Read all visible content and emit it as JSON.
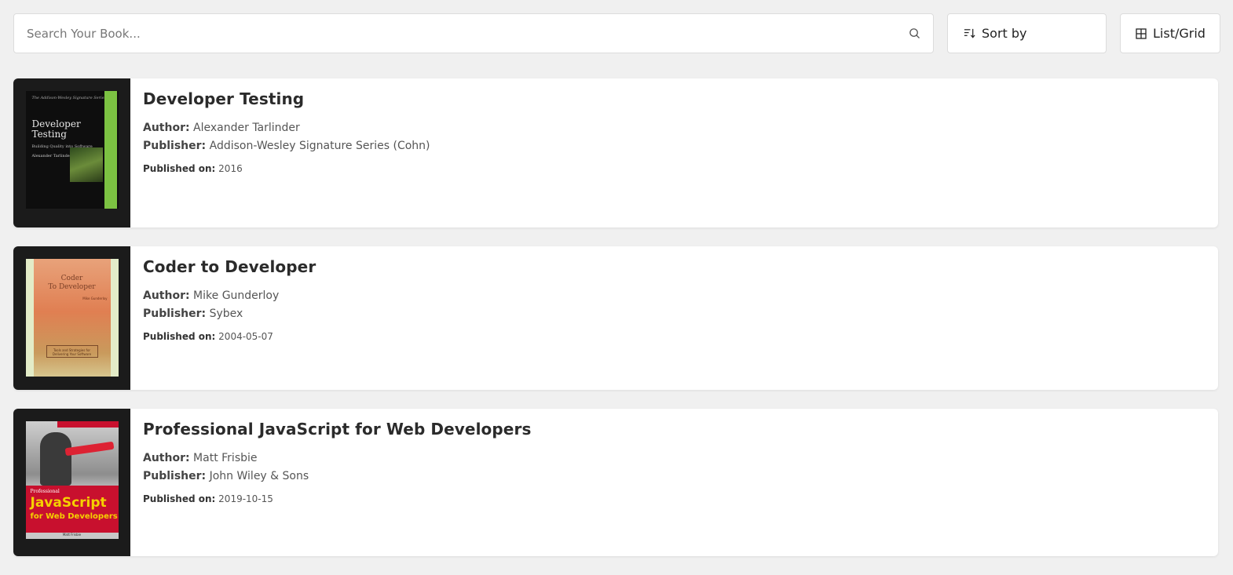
{
  "toolbar": {
    "search_placeholder": "Search Your Book...",
    "sort_label": "Sort by",
    "view_label": "List/Grid"
  },
  "labels": {
    "author": "Author:",
    "publisher": "Publisher:",
    "published_on": "Published on:"
  },
  "books": [
    {
      "title": "Developer Testing",
      "author": "Alexander Tarlinder",
      "publisher": "Addison-Wesley Signature Series (Cohn)",
      "published": "2016",
      "cover": {
        "series": "The Addison-Wesley Signature Series",
        "title_line1": "Developer",
        "title_line2": "Testing",
        "subtitle": "Building Quality into Software",
        "author": "Alexander Tarlinder",
        "accent": "#7cc242"
      }
    },
    {
      "title": "Coder to Developer",
      "author": "Mike Gunderloy",
      "publisher": "Sybex",
      "published": "2004-05-07",
      "cover": {
        "title_line1": "Coder",
        "title_line2": "To Developer",
        "author": "Mike Gunderloy",
        "tagline": "Tools and Strategies for Delivering Your Software"
      }
    },
    {
      "title": "Professional JavaScript for Web Developers",
      "author": "Matt Frisbie",
      "publisher": "John Wiley & Sons",
      "published": "2019-10-15",
      "cover": {
        "line1": "Professional",
        "line2": "JavaScript",
        "line3": "for Web Developers",
        "author": "Matt Frisbie",
        "accent": "#c8102e"
      }
    }
  ]
}
